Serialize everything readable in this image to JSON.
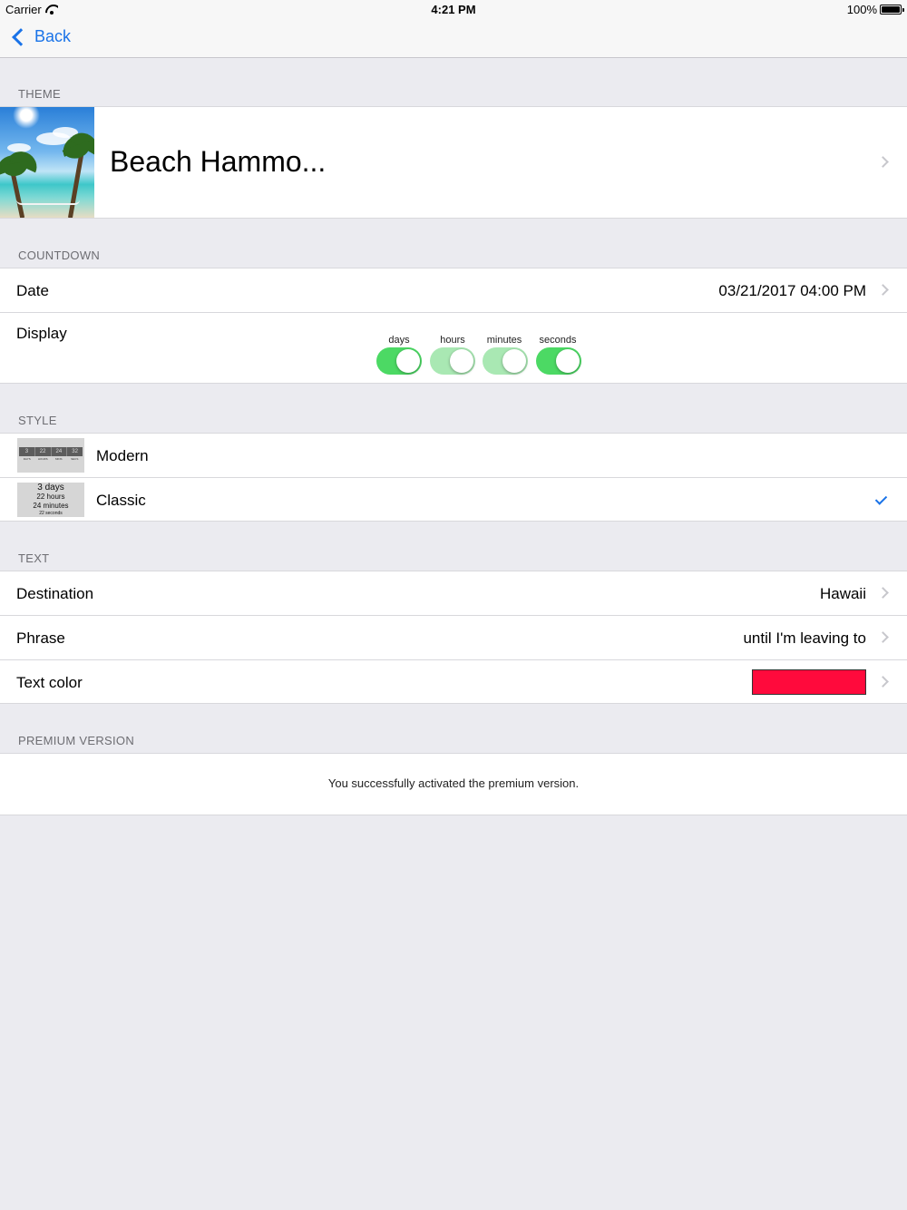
{
  "status_bar": {
    "carrier": "Carrier",
    "time": "4:21 PM",
    "battery": "100%"
  },
  "nav": {
    "back_label": "Back"
  },
  "sections": {
    "theme": "THEME",
    "countdown": "COUNTDOWN",
    "style": "STYLE",
    "text": "TEXT",
    "premium": "PREMIUM VERSION"
  },
  "theme": {
    "title": "Beach Hammo..."
  },
  "countdown": {
    "date_label": "Date",
    "date_value": "03/21/2017 04:00 PM",
    "display_label": "Display",
    "toggles": [
      {
        "label": "days",
        "state": "on"
      },
      {
        "label": "hours",
        "state": "on-dimmed"
      },
      {
        "label": "minutes",
        "state": "on-dimmed"
      },
      {
        "label": "seconds",
        "state": "on"
      }
    ]
  },
  "style": {
    "items": [
      {
        "label": "Modern",
        "selected": false,
        "thumb": {
          "values": [
            "3",
            "22",
            "24",
            "32"
          ],
          "units": [
            "DAYS",
            "HOURS",
            "MINS",
            "SECS"
          ]
        }
      },
      {
        "label": "Classic",
        "selected": true,
        "thumb": {
          "lines": [
            "3 days",
            "22 hours",
            "24 minutes",
            "22 seconds"
          ]
        }
      }
    ]
  },
  "text": {
    "destination_label": "Destination",
    "destination_value": "Hawaii",
    "phrase_label": "Phrase",
    "phrase_value": "until I'm leaving to",
    "color_label": "Text color",
    "color_value": "#ff0a3c"
  },
  "premium": {
    "message": "You successfully activated the premium version."
  },
  "colors": {
    "accent": "#1a73e8",
    "switch_on": "#4cd964",
    "switch_dimmed": "#a9e8b3"
  }
}
